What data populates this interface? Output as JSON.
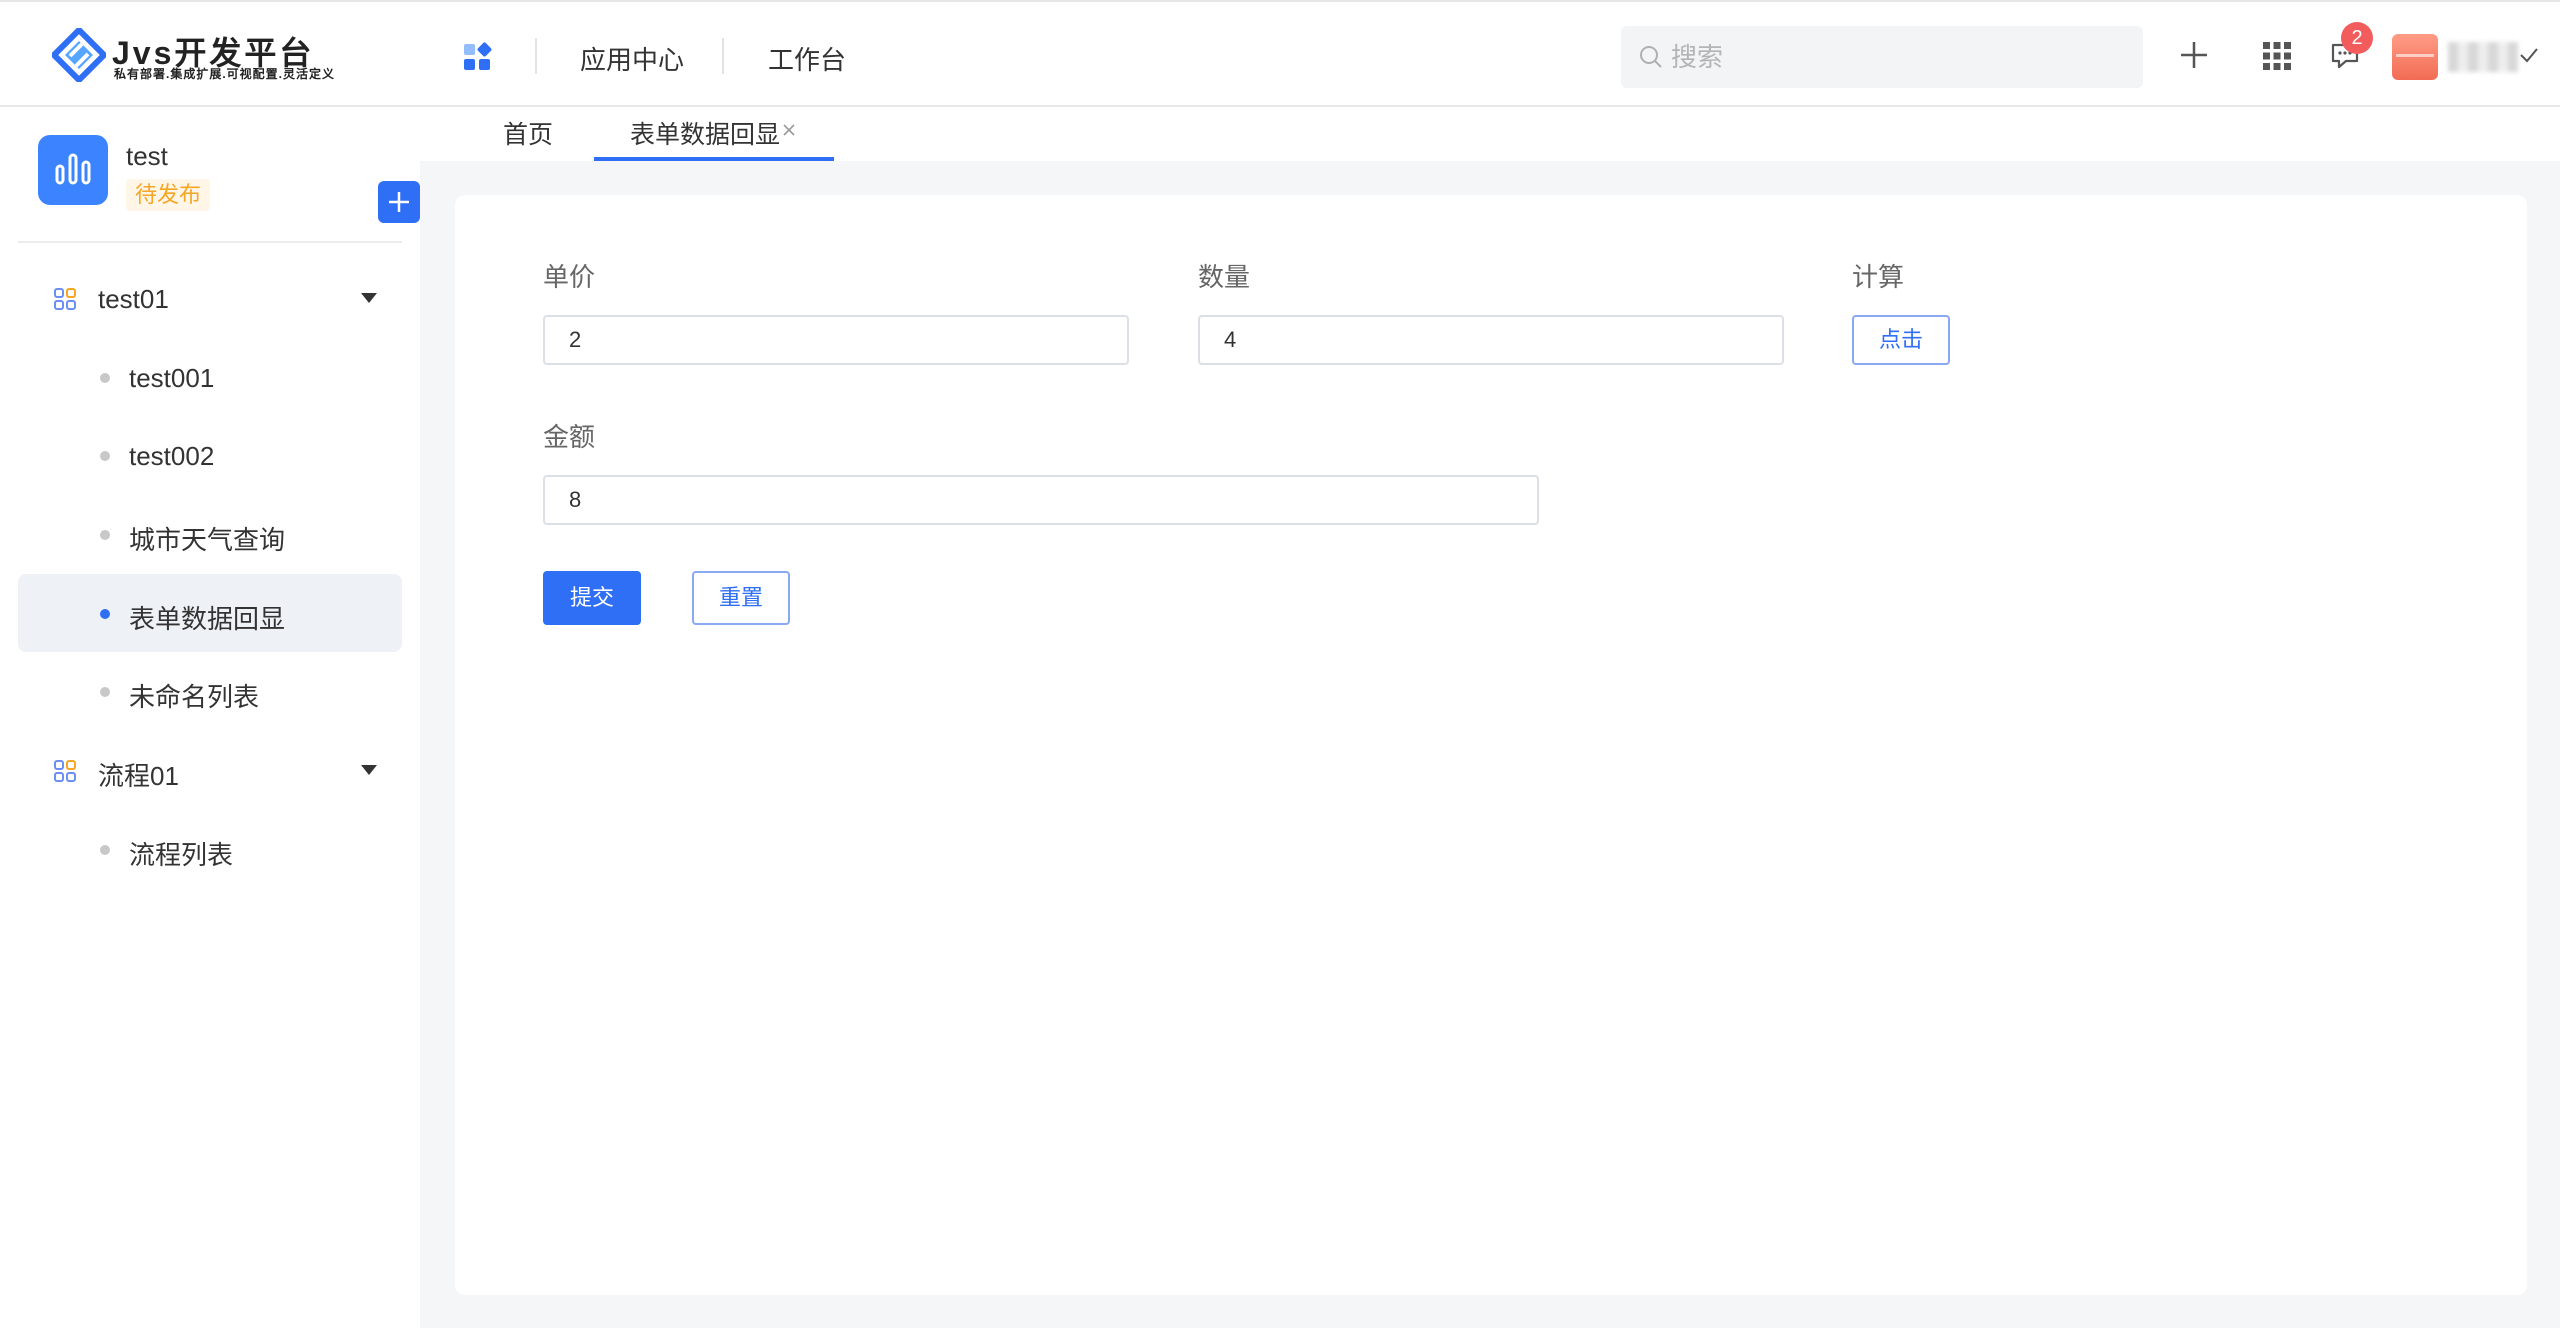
{
  "header": {
    "logo": {
      "title": "Jvs开发平台",
      "slogan": "私有部署.集成扩展.可视配置.灵活定义"
    },
    "nav": [
      {
        "label": "应用中心"
      },
      {
        "label": "工作台"
      }
    ],
    "search": {
      "placeholder": "搜索",
      "value": ""
    },
    "notifications": {
      "count": "2"
    },
    "icons": [
      "apps-grid-icon",
      "search-icon",
      "plus-icon",
      "grid-icon",
      "message-icon",
      "check-icon"
    ],
    "colors": {
      "accent": "#2f6ff5",
      "badge": "#f25c5c"
    }
  },
  "sidebar": {
    "project": {
      "name": "test",
      "status": "待发布"
    },
    "groups": [
      {
        "label": "test01",
        "items": [
          {
            "label": "test001"
          },
          {
            "label": "test002"
          },
          {
            "label": "城市天气查询"
          },
          {
            "label": "表单数据回显",
            "active": true
          },
          {
            "label": "未命名列表"
          }
        ]
      },
      {
        "label": "流程01",
        "items": [
          {
            "label": "流程列表"
          }
        ]
      }
    ]
  },
  "tabs": [
    {
      "label": "首页"
    },
    {
      "label": "表单数据回显",
      "active": true,
      "closable": true
    }
  ],
  "form": {
    "unit_price": {
      "label": "单价",
      "value": "2"
    },
    "quantity": {
      "label": "数量",
      "value": "4"
    },
    "calculate": {
      "label": "计算",
      "button": "点击"
    },
    "amount": {
      "label": "金额",
      "value": "8"
    },
    "submit_label": "提交",
    "reset_label": "重置"
  }
}
